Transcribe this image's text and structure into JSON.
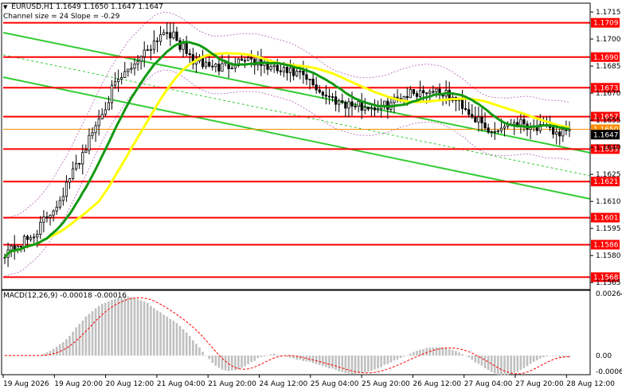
{
  "header": {
    "symbol": "EURUSD,H1",
    "ohlc": "1.1649 1.1650 1.1647 1.1647",
    "indicator": "Channel size = 24 Slope = -0.29"
  },
  "macd": {
    "label": "MACD(12,26,9) -0.00018 -0.00016"
  },
  "chart_data": {
    "type": "candlestick",
    "instrument": "EURUSD",
    "timeframe": "H1",
    "price_axis": {
      "ticks": [
        "1.1715",
        "1.1700",
        "1.1685",
        "1.1670",
        "1.1655",
        "1.1640",
        "1.1625",
        "1.1610",
        "1.1595",
        "1.1580",
        "1.1565"
      ],
      "range": [
        1.1562,
        1.1719
      ]
    },
    "time_axis": {
      "labels": [
        "19 Aug 2026",
        "19 Aug 20:00",
        "20 Aug 12:00",
        "21 Aug 04:00",
        "21 Aug 20:00",
        "24 Aug 12:00",
        "25 Aug 04:00",
        "25 Aug 20:00",
        "26 Aug 12:00",
        "27 Aug 04:00",
        "27 Aug 20:00",
        "28 Aug 12:00"
      ]
    },
    "levels": [
      {
        "label": "1.1709",
        "value": 1.1709,
        "color": "#ff0000"
      },
      {
        "label": "1.1690",
        "value": 1.169,
        "color": "#ff0000"
      },
      {
        "label": "1.1673",
        "value": 1.1673,
        "color": "#ff0000"
      },
      {
        "label": "1.1657",
        "value": 1.1657,
        "color": "#ff0000"
      },
      {
        "label": "1.1650",
        "value": 1.165,
        "color": "#ff8c00"
      },
      {
        "label": "1.1647",
        "value": 1.1647,
        "color": "#000000"
      },
      {
        "label": "1.1639",
        "value": 1.1639,
        "color": "#ff0000"
      },
      {
        "label": "1.1621",
        "value": 1.1621,
        "color": "#ff0000"
      },
      {
        "label": "1.1601",
        "value": 1.1601,
        "color": "#ff0000"
      },
      {
        "label": "1.1586",
        "value": 1.1586,
        "color": "#ff0000"
      },
      {
        "label": "1.1568",
        "value": 1.1568,
        "color": "#ff0000"
      }
    ],
    "key_prices": [
      1.1582,
      1.159,
      1.161,
      1.164,
      1.1672,
      1.169,
      1.1706,
      1.1688,
      1.1684,
      1.169,
      1.1683,
      1.168,
      1.1668,
      1.1663,
      1.1662,
      1.167,
      1.1672,
      1.1664,
      1.1648,
      1.1655,
      1.165,
      1.1647
    ],
    "channel": {
      "slope": -0.29,
      "size": 24,
      "color": "#33cc33"
    },
    "moving_averages": [
      {
        "color": "#ffff00"
      },
      {
        "color": "#119911"
      }
    ],
    "macd_axis": {
      "ticks": [
        "0.00264",
        "0.00",
        "-0.00068"
      ],
      "range": [
        -0.00068,
        0.00264
      ],
      "main": -0.00018,
      "signal": -0.00016
    },
    "colors": {
      "accent": "#ff0000",
      "channel": "#33cc33",
      "ma_fast": "#ffff00",
      "ma_slow": "#119911",
      "histogram": "#c0c0c0"
    },
    "grid": false
  }
}
